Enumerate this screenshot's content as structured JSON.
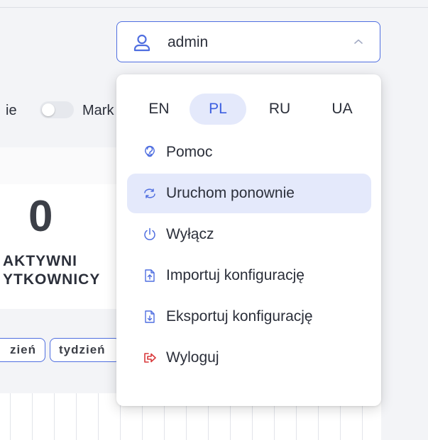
{
  "header": {
    "user_name": "admin"
  },
  "background": {
    "toggle_row_left_text": "ie",
    "toggle_row_right_text": "Mark",
    "stat_value": "0",
    "stat_label_line1": "AKTYWNI",
    "stat_label_line2": "YTKOWNICY",
    "period_buttons": [
      "zień",
      "tydzień"
    ]
  },
  "menu": {
    "languages": [
      {
        "code": "EN",
        "active": false
      },
      {
        "code": "PL",
        "active": true
      },
      {
        "code": "RU",
        "active": false
      },
      {
        "code": "UA",
        "active": false
      }
    ],
    "items": [
      {
        "label": "Pomoc",
        "icon": "help-icon"
      },
      {
        "label": "Uruchom ponownie",
        "icon": "restart-icon"
      },
      {
        "label": "Wyłącz",
        "icon": "power-icon"
      },
      {
        "label": "Importuj konfigurację",
        "icon": "file-import-icon"
      },
      {
        "label": "Eksportuj konfigurację",
        "icon": "file-export-icon"
      },
      {
        "label": "Wyloguj",
        "icon": "logout-icon"
      }
    ]
  },
  "colors": {
    "accent": "#4f6ee0",
    "active_bg": "#e4e9fb",
    "logout": "#d9383a"
  }
}
